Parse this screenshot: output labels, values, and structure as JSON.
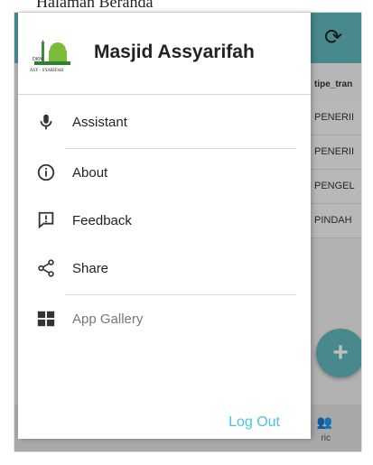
{
  "caption": "Halaman Beranda",
  "background_app": {
    "refresh_icon": "refresh-icon",
    "column_header": "tipe_tran",
    "rows": [
      "PENERII",
      "PENERII",
      "PENGEL",
      "PINDAH"
    ],
    "fab_label": "+",
    "bottom_nav_label": "ric"
  },
  "drawer": {
    "title": "Masjid Assyarifah",
    "logo_text": "ASY - SYARIFAH",
    "menu": [
      {
        "label": "Assistant",
        "icon": "mic-icon"
      },
      {
        "label": "About",
        "icon": "info-icon"
      },
      {
        "label": "Feedback",
        "icon": "feedback-icon"
      },
      {
        "label": "Share",
        "icon": "share-icon"
      },
      {
        "label": "App Gallery",
        "icon": "grid-icon"
      }
    ],
    "logout_label": "Log Out"
  },
  "colors": {
    "accent": "#5fb7bb",
    "link": "#4cc3e4"
  }
}
